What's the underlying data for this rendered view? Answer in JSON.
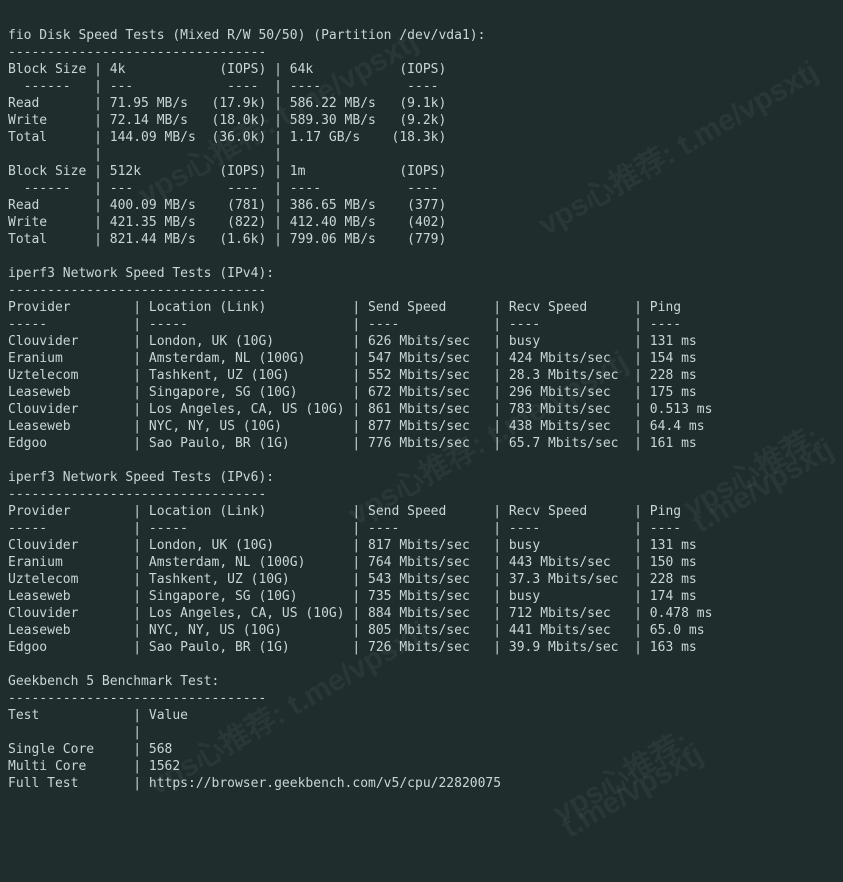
{
  "watermark": "vps心推荐: t.me/vpsxtj",
  "disk": {
    "title": "fio Disk Speed Tests (Mixed R/W 50/50) (Partition /dev/vda1):",
    "sep": "---------------------------------",
    "header1": "Block Size | 4k            (IOPS) | 64k           (IOPS)",
    "divider1": "  ------   | ---            ----  | ----           ----",
    "read1": "Read       | 71.95 MB/s   (17.9k) | 586.22 MB/s   (9.1k)",
    "write1": "Write      | 72.14 MB/s   (18.0k) | 589.30 MB/s   (9.2k)",
    "total1": "Total      | 144.09 MB/s  (36.0k) | 1.17 GB/s    (18.3k)",
    "blank1": "           |                      |",
    "header2": "Block Size | 512k          (IOPS) | 1m            (IOPS)",
    "divider2": "  ------   | ---            ----  | ----           ----",
    "read2": "Read       | 400.09 MB/s    (781) | 386.65 MB/s    (377)",
    "write2": "Write      | 421.35 MB/s    (822) | 412.40 MB/s    (402)",
    "total2": "Total      | 821.44 MB/s   (1.6k) | 799.06 MB/s    (779)"
  },
  "ipv4": {
    "title": "iperf3 Network Speed Tests (IPv4):",
    "sep": "---------------------------------",
    "header": "Provider        | Location (Link)           | Send Speed      | Recv Speed      | Ping",
    "divider": "-----           | -----                     | ----            | ----            | ----",
    "rows": [
      "Clouvider       | London, UK (10G)          | 626 Mbits/sec   | busy            | 131 ms",
      "Eranium         | Amsterdam, NL (100G)      | 547 Mbits/sec   | 424 Mbits/sec   | 154 ms",
      "Uztelecom       | Tashkent, UZ (10G)        | 552 Mbits/sec   | 28.3 Mbits/sec  | 228 ms",
      "Leaseweb        | Singapore, SG (10G)       | 672 Mbits/sec   | 296 Mbits/sec   | 175 ms",
      "Clouvider       | Los Angeles, CA, US (10G) | 861 Mbits/sec   | 783 Mbits/sec   | 0.513 ms",
      "Leaseweb        | NYC, NY, US (10G)         | 877 Mbits/sec   | 438 Mbits/sec   | 64.4 ms",
      "Edgoo           | Sao Paulo, BR (1G)        | 776 Mbits/sec   | 65.7 Mbits/sec  | 161 ms"
    ]
  },
  "ipv6": {
    "title": "iperf3 Network Speed Tests (IPv6):",
    "sep": "---------------------------------",
    "header": "Provider        | Location (Link)           | Send Speed      | Recv Speed      | Ping",
    "divider": "-----           | -----                     | ----            | ----            | ----",
    "rows": [
      "Clouvider       | London, UK (10G)          | 817 Mbits/sec   | busy            | 131 ms",
      "Eranium         | Amsterdam, NL (100G)      | 764 Mbits/sec   | 443 Mbits/sec   | 150 ms",
      "Uztelecom       | Tashkent, UZ (10G)        | 543 Mbits/sec   | 37.3 Mbits/sec  | 228 ms",
      "Leaseweb        | Singapore, SG (10G)       | 735 Mbits/sec   | busy            | 174 ms",
      "Clouvider       | Los Angeles, CA, US (10G) | 884 Mbits/sec   | 712 Mbits/sec   | 0.478 ms",
      "Leaseweb        | NYC, NY, US (10G)         | 805 Mbits/sec   | 441 Mbits/sec   | 65.0 ms",
      "Edgoo           | Sao Paulo, BR (1G)        | 726 Mbits/sec   | 39.9 Mbits/sec  | 163 ms"
    ]
  },
  "geekbench": {
    "title": "Geekbench 5 Benchmark Test:",
    "sep": "---------------------------------",
    "header": "Test            | Value",
    "blank": "                |",
    "single": "Single Core     | 568",
    "multi": "Multi Core      | 1562",
    "full": "Full Test       | https://browser.geekbench.com/v5/cpu/22820075"
  }
}
